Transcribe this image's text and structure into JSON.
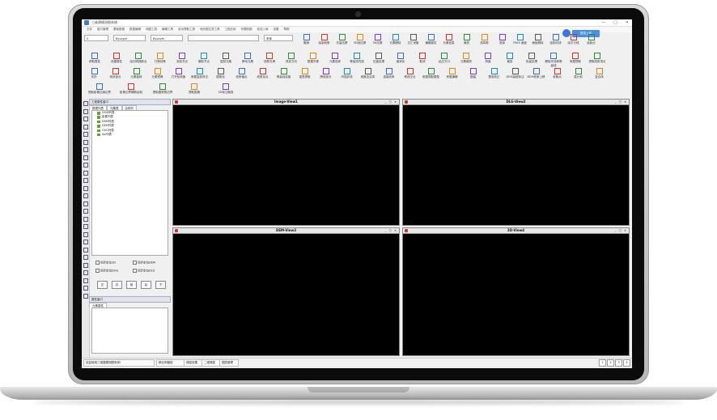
{
  "window": {
    "title": "三维建模测图系统",
    "controls": [
      "—",
      "□",
      "✕"
    ]
  },
  "menu": [
    "文件",
    "窗口管理",
    "基础数据",
    "数据编辑",
    "测图工具",
    "编辑工具",
    "自动提取工具",
    "地形图生成工具",
    "工程应用",
    "专题制图",
    "检查入库",
    "设置",
    "帮助"
  ],
  "login": {
    "label": "登录上线"
  },
  "toolbar1": {
    "combo_layer_num": "0",
    "combo_layer1": "ByLayer",
    "combo_layer2": "ByLayer",
    "combo_blank": "",
    "combo_font": "宋体",
    "tools": [
      "撤销",
      "绘制线条",
      "矢量压屏",
      "3D线压屏",
      "3D压屏",
      "元素删除",
      "交汇采集",
      "编辑属性",
      "元素信息",
      "裁剪",
      "选择框",
      "选择",
      "FEKE 面板",
      "面板删除",
      "绘制切线",
      "绘平行线",
      "绘制点"
    ]
  },
  "toolbar2": {
    "tools": [
      "获取属性",
      "设置属性",
      "绘切线捕获点",
      "打断线条",
      "添加节点",
      "删除节点",
      "复制元素",
      "移动元素",
      "线条光滑",
      "改变方向",
      "数据平移",
      "元素选择",
      "等高线内插",
      "压盖处理",
      "面状化",
      "取消",
      "绘交叉口",
      "元素裁剪",
      "构面",
      "裁剪",
      "批量处理",
      "删除河流和等高线",
      "房屋提取",
      "提取线条顶点"
    ]
  },
  "toolbar3": {
    "tools": [
      "拓扑",
      "线状延长",
      "元素旋转",
      "元素镜像",
      "打开检测面",
      "房屋复制双击",
      "图角化",
      "线条偏点",
      "线条加点",
      "等高线连接",
      "重叠提取",
      "跨线延长",
      "内插补线",
      "坡度至实体",
      "连接线条",
      "修改交点",
      "房屋提取模型",
      "房屋编辑",
      "图幅",
      "基准校正",
      "DEM高程标注",
      "DEM线条上移",
      "参数点",
      "重计划",
      "复合体"
    ]
  },
  "toolbar4": {
    "tools": [
      "提取影像边缘边界",
      "影像边界辅助绘制",
      "提取建筑物边界",
      "提取围墙",
      "3D标注裁剪"
    ]
  },
  "left_panel": {
    "title": "工程属性窗口",
    "tabs": [
      "数据列表",
      "元素表",
      "比例尺"
    ],
    "tree": [
      "DOM列表",
      "影像列表",
      "DSM列表",
      "DEM列表",
      "OSG列表",
      "las列表"
    ],
    "checks": [
      "同步定位3D",
      "同步定位DEM",
      "同步定位DOG",
      "同步定位DLG"
    ],
    "nav": [
      "左",
      "右",
      "前",
      "后",
      "下"
    ]
  },
  "props_panel": {
    "title": "属性窗口",
    "tab": "元素属性"
  },
  "views": [
    {
      "title": "Image-View1"
    },
    {
      "title": "DLG-View2"
    },
    {
      "title": "DEM-View3"
    },
    {
      "title": "3D-View4"
    }
  ],
  "view_controls": "_ □ ✕",
  "status": {
    "message": "欢迎使用三维建模测图系统!",
    "mode": "精比例缩放",
    "s1": "捕捉设置",
    "s2": "二维捕捉",
    "s3": "图层管理",
    "pages": [
      "1",
      "2",
      "3",
      "4"
    ]
  }
}
